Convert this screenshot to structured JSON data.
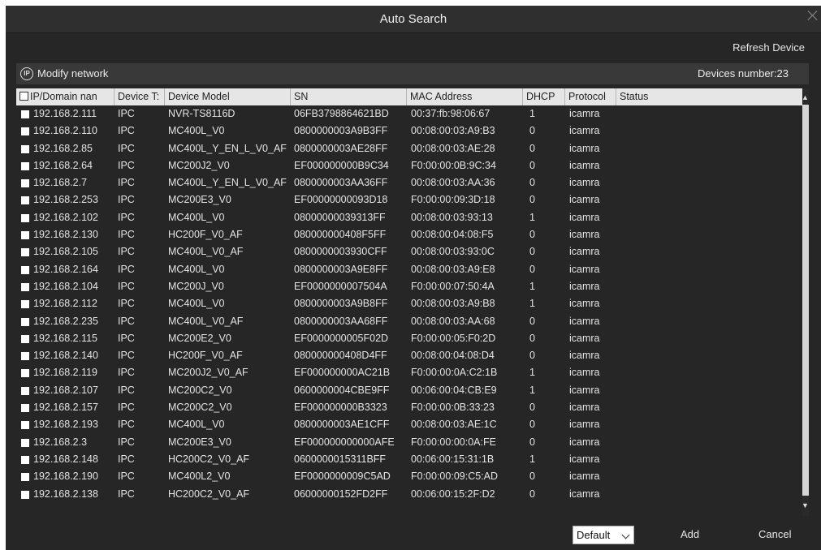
{
  "window": {
    "title": "Auto Search"
  },
  "toolbar": {
    "refresh_label": "Refresh Device",
    "ip_icon_text": "IP",
    "modify_label": "Modify network",
    "devices_count": "Devices number:23"
  },
  "columns": [
    "IP/Domain nan",
    "Device T:",
    "Device Model",
    "SN",
    "MAC Address",
    "DHCP",
    "Protocol",
    "Status"
  ],
  "rows": [
    {
      "ip": "192.168.2.111",
      "type": "IPC",
      "model": "NVR-TS8116D",
      "sn": "06FB3798864621BD",
      "mac": "00:37:fb:98:06:67",
      "dhcp": "1",
      "protocol": "icamra"
    },
    {
      "ip": "192.168.2.110",
      "type": "IPC",
      "model": "MC400L_V0",
      "sn": "0800000003A9B3FF",
      "mac": "00:08:00:03:A9:B3",
      "dhcp": "0",
      "protocol": "icamra"
    },
    {
      "ip": "192.168.2.85",
      "type": "IPC",
      "model": "MC400L_Y_EN_L_V0_AF",
      "sn": "0800000003AE28FF",
      "mac": "00:08:00:03:AE:28",
      "dhcp": "0",
      "protocol": "icamra"
    },
    {
      "ip": "192.168.2.64",
      "type": "IPC",
      "model": "MC200J2_V0",
      "sn": "EF000000000B9C34",
      "mac": "F0:00:00:0B:9C:34",
      "dhcp": "0",
      "protocol": "icamra"
    },
    {
      "ip": "192.168.2.7",
      "type": "IPC",
      "model": "MC400L_Y_EN_L_V0_AF",
      "sn": "0800000003AA36FF",
      "mac": "00:08:00:03:AA:36",
      "dhcp": "0",
      "protocol": "icamra"
    },
    {
      "ip": "192.168.2.253",
      "type": "IPC",
      "model": "MC200E3_V0",
      "sn": "EF00000000093D18",
      "mac": "F0:00:00:09:3D:18",
      "dhcp": "0",
      "protocol": "icamra"
    },
    {
      "ip": "192.168.2.102",
      "type": "IPC",
      "model": "MC400L_V0",
      "sn": "08000000039313FF",
      "mac": "00:08:00:03:93:13",
      "dhcp": "1",
      "protocol": "icamra"
    },
    {
      "ip": "192.168.2.130",
      "type": "IPC",
      "model": "HC200F_V0_AF",
      "sn": "080000000408F5FF",
      "mac": "00:08:00:04:08:F5",
      "dhcp": "0",
      "protocol": "icamra"
    },
    {
      "ip": "192.168.2.105",
      "type": "IPC",
      "model": "MC400L_V0_AF",
      "sn": "0800000003930CFF",
      "mac": "00:08:00:03:93:0C",
      "dhcp": "0",
      "protocol": "icamra"
    },
    {
      "ip": "192.168.2.164",
      "type": "IPC",
      "model": "MC400L_V0",
      "sn": "0800000003A9E8FF",
      "mac": "00:08:00:03:A9:E8",
      "dhcp": "0",
      "protocol": "icamra"
    },
    {
      "ip": "192.168.2.104",
      "type": "IPC",
      "model": "MC200J_V0",
      "sn": "EF0000000007504A",
      "mac": "F0:00:00:07:50:4A",
      "dhcp": "1",
      "protocol": "icamra"
    },
    {
      "ip": "192.168.2.112",
      "type": "IPC",
      "model": "MC400L_V0",
      "sn": "0800000003A9B8FF",
      "mac": "00:08:00:03:A9:B8",
      "dhcp": "1",
      "protocol": "icamra"
    },
    {
      "ip": "192.168.2.235",
      "type": "IPC",
      "model": "MC400L_V0_AF",
      "sn": "0800000003AA68FF",
      "mac": "00:08:00:03:AA:68",
      "dhcp": "0",
      "protocol": "icamra"
    },
    {
      "ip": "192.168.2.115",
      "type": "IPC",
      "model": "MC200E2_V0",
      "sn": "EF0000000005F02D",
      "mac": "F0:00:00:05:F0:2D",
      "dhcp": "0",
      "protocol": "icamra"
    },
    {
      "ip": "192.168.2.140",
      "type": "IPC",
      "model": "HC200F_V0_AF",
      "sn": "080000000408D4FF",
      "mac": "00:08:00:04:08:D4",
      "dhcp": "0",
      "protocol": "icamra"
    },
    {
      "ip": "192.168.2.119",
      "type": "IPC",
      "model": "MC200J2_V0_AF",
      "sn": "EF000000000AC21B",
      "mac": "F0:00:00:0A:C2:1B",
      "dhcp": "1",
      "protocol": "icamra"
    },
    {
      "ip": "192.168.2.107",
      "type": "IPC",
      "model": "MC200C2_V0",
      "sn": "0600000004CBE9FF",
      "mac": "00:06:00:04:CB:E9",
      "dhcp": "1",
      "protocol": "icamra"
    },
    {
      "ip": "192.168.2.157",
      "type": "IPC",
      "model": "MC200C2_V0",
      "sn": "EF000000000B3323",
      "mac": "F0:00:00:0B:33:23",
      "dhcp": "0",
      "protocol": "icamra"
    },
    {
      "ip": "192.168.2.193",
      "type": "IPC",
      "model": "MC400L_V0",
      "sn": "0800000003AE1CFF",
      "mac": "00:08:00:03:AE:1C",
      "dhcp": "0",
      "protocol": "icamra"
    },
    {
      "ip": "192.168.2.3",
      "type": "IPC",
      "model": "MC200E3_V0",
      "sn": "EF000000000000AFE",
      "mac": "F0:00:00:00:0A:FE",
      "dhcp": "0",
      "protocol": "icamra"
    },
    {
      "ip": "192.168.2.148",
      "type": "IPC",
      "model": "HC200C2_V0_AF",
      "sn": "0600000015311BFF",
      "mac": "00:06:00:15:31:1B",
      "dhcp": "1",
      "protocol": "icamra"
    },
    {
      "ip": "192.168.2.190",
      "type": "IPC",
      "model": "MC400L2_V0",
      "sn": "EF0000000009C5AD",
      "mac": "F0:00:00:09:C5:AD",
      "dhcp": "0",
      "protocol": "icamra"
    },
    {
      "ip": "192.168.2.138",
      "type": "IPC",
      "model": "HC200C2_V0_AF",
      "sn": "06000000152FD2FF",
      "mac": "00:06:00:15:2F:D2",
      "dhcp": "0",
      "protocol": "icamra"
    }
  ],
  "footer": {
    "protocol_select": "Default",
    "add_label": "Add",
    "cancel_label": "Cancel"
  }
}
